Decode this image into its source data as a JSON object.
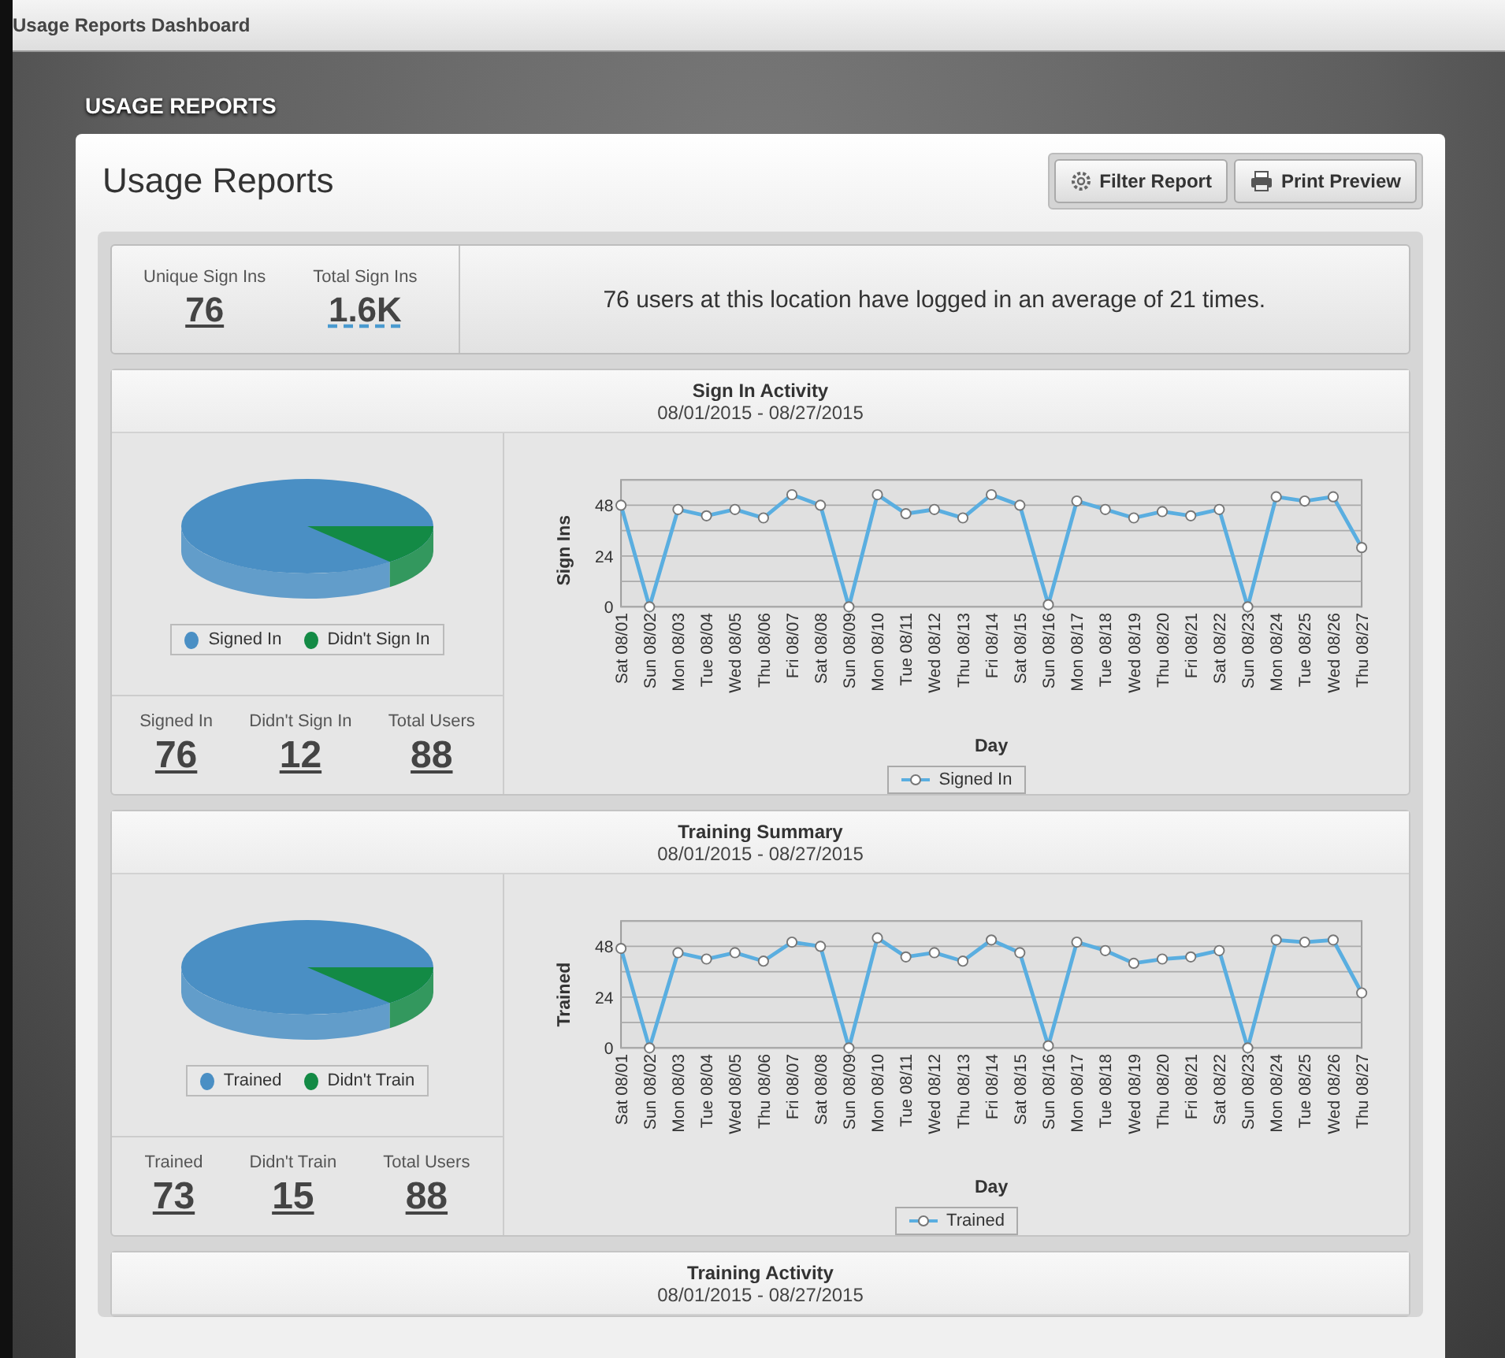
{
  "window": {
    "title": "Usage Reports Dashboard"
  },
  "page_heading": "USAGE REPORTS",
  "card": {
    "title": "Usage Reports",
    "buttons": [
      {
        "label": "Filter Report",
        "kind": "filter"
      },
      {
        "label": "Print Preview",
        "kind": "print"
      }
    ]
  },
  "summary": {
    "stats": [
      {
        "label": "Unique Sign Ins",
        "value": "76",
        "kind": "solid"
      },
      {
        "label": "Total Sign Ins",
        "value": "1.6K",
        "kind": "dashed"
      }
    ],
    "message": "76 users at this location have logged in an average of 21 times."
  },
  "sections": [
    {
      "title": "Sign In Activity",
      "date_range": "08/01/2015 - 08/27/2015",
      "pie_legend": [
        {
          "label": "Signed In",
          "color": "#4a8fc4"
        },
        {
          "label": "Didn't Sign In",
          "color": "#138a45"
        }
      ],
      "stats": [
        {
          "label": "Signed In",
          "value": "76"
        },
        {
          "label": "Didn't Sign In",
          "value": "12"
        },
        {
          "label": "Total Users",
          "value": "88"
        }
      ],
      "chart_data": {
        "type": "line",
        "xlabel": "Day",
        "ylabel": "Sign Ins",
        "categories": [
          "Sat 08/01",
          "Sun 08/02",
          "Mon 08/03",
          "Tue 08/04",
          "Wed 08/05",
          "Thu 08/06",
          "Fri 08/07",
          "Sat 08/08",
          "Sun 08/09",
          "Mon 08/10",
          "Tue 08/11",
          "Wed 08/12",
          "Thu 08/13",
          "Fri 08/14",
          "Sat 08/15",
          "Sun 08/16",
          "Mon 08/17",
          "Tue 08/18",
          "Wed 08/19",
          "Thu 08/20",
          "Fri 08/21",
          "Sat 08/22",
          "Sun 08/23",
          "Mon 08/24",
          "Tue 08/25",
          "Wed 08/26",
          "Thu 08/27"
        ],
        "series": [
          {
            "name": "Signed In",
            "color": "#5aaee0",
            "marker": "circle",
            "values": [
              48,
              0,
              46,
              43,
              46,
              42,
              53,
              48,
              0,
              53,
              44,
              46,
              42,
              53,
              48,
              1,
              50,
              46,
              42,
              45,
              43,
              46,
              0,
              52,
              50,
              52,
              28
            ]
          }
        ],
        "ylim": [
          0,
          60
        ],
        "yticks": [
          0,
          24,
          48
        ]
      }
    },
    {
      "title": "Training Summary",
      "date_range": "08/01/2015 - 08/27/2015",
      "pie_legend": [
        {
          "label": "Trained",
          "color": "#4a8fc4"
        },
        {
          "label": "Didn't Train",
          "color": "#138a45"
        }
      ],
      "stats": [
        {
          "label": "Trained",
          "value": "73"
        },
        {
          "label": "Didn't Train",
          "value": "15"
        },
        {
          "label": "Total Users",
          "value": "88"
        }
      ],
      "chart_data": {
        "type": "line",
        "xlabel": "Day",
        "ylabel": "Trained",
        "categories": [
          "Sat 08/01",
          "Sun 08/02",
          "Mon 08/03",
          "Tue 08/04",
          "Wed 08/05",
          "Thu 08/06",
          "Fri 08/07",
          "Sat 08/08",
          "Sun 08/09",
          "Mon 08/10",
          "Tue 08/11",
          "Wed 08/12",
          "Thu 08/13",
          "Fri 08/14",
          "Sat 08/15",
          "Sun 08/16",
          "Mon 08/17",
          "Tue 08/18",
          "Wed 08/19",
          "Thu 08/20",
          "Fri 08/21",
          "Sat 08/22",
          "Sun 08/23",
          "Mon 08/24",
          "Tue 08/25",
          "Wed 08/26",
          "Thu 08/27"
        ],
        "series": [
          {
            "name": "Trained",
            "color": "#5aaee0",
            "marker": "circle",
            "values": [
              47,
              0,
              45,
              42,
              45,
              41,
              50,
              48,
              0,
              52,
              43,
              45,
              41,
              51,
              45,
              1,
              50,
              46,
              40,
              42,
              43,
              46,
              0,
              51,
              50,
              51,
              26
            ]
          }
        ],
        "ylim": [
          0,
          60
        ],
        "yticks": [
          0,
          24,
          48
        ]
      }
    },
    {
      "title": "Training Activity",
      "date_range": "08/01/2015 - 08/27/2015"
    }
  ]
}
